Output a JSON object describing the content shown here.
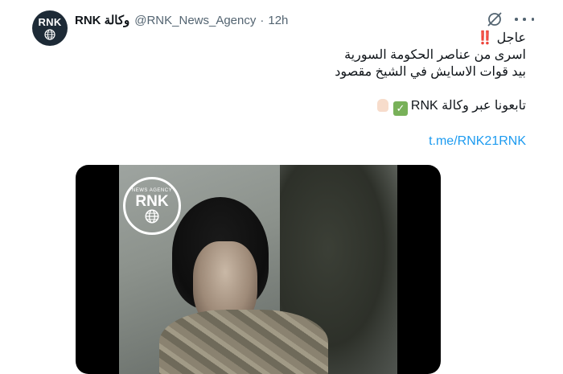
{
  "author": {
    "avatar_text": "RNK",
    "display_name": "RNK وكالة",
    "handle": "@RNK_News_Agency",
    "separator": "·",
    "time": "12h"
  },
  "icons": {
    "grok": "grok-icon",
    "more": "more-icon"
  },
  "tweet": {
    "urgent_label": "عاجل",
    "urgent_emoji": "‼️",
    "line1": "اسرى من عناصر الحكومة السورية",
    "line2": "بيد قوات الاسايش في الشيخ مقصود",
    "follow_text": "تابعونا عبر وكالة RNK",
    "check_emoji": "✅",
    "hand_emoji": "👎🏻",
    "link": "t.me/RNK21RNK"
  },
  "media": {
    "watermark_small": "NEWS AGENCY",
    "watermark_text": "RNK"
  },
  "colors": {
    "link": "#1d9bf0",
    "secondary_text": "#536471",
    "urgent": "#d0021b"
  }
}
